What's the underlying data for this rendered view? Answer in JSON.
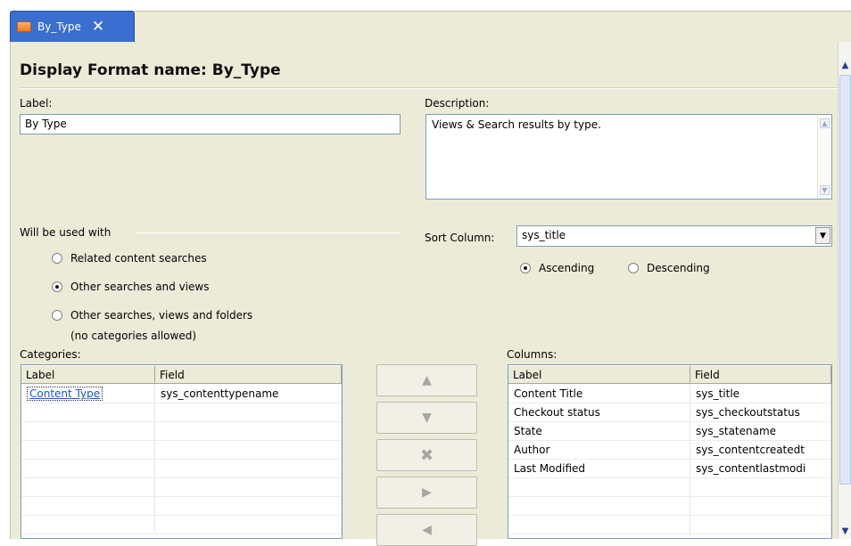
{
  "tab": {
    "title": "By_Type",
    "close_glyph": "✕",
    "icon": "display-format-icon"
  },
  "header": {
    "title": "Display Format name: By_Type"
  },
  "label_field": {
    "label": "Label:",
    "value": "By Type"
  },
  "description_field": {
    "label": "Description:",
    "value": "Views & Search results by type."
  },
  "usage": {
    "group_label": "Will be used with",
    "options": [
      {
        "label": "Related content searches",
        "selected": false
      },
      {
        "label": "Other searches and views",
        "selected": true
      },
      {
        "label": "Other searches, views and folders",
        "sublabel": "(no categories allowed)",
        "selected": false
      }
    ]
  },
  "sort": {
    "label": "Sort Column:",
    "value": "sys_title",
    "ascending": "Ascending",
    "descending": "Descending",
    "selected": "ascending"
  },
  "categories": {
    "label": "Categories:",
    "headers": [
      "Label",
      "Field"
    ],
    "rows": [
      [
        "Content Type",
        "sys_contenttypename"
      ]
    ]
  },
  "move_buttons": [
    "move-up-icon",
    "move-down-icon",
    "remove-icon",
    "move-right-icon",
    "move-left-icon"
  ],
  "columns": {
    "label": "Columns:",
    "headers": [
      "Label",
      "Field"
    ],
    "rows": [
      [
        "Content Title",
        "sys_title"
      ],
      [
        "Checkout status",
        "sys_checkoutstatus"
      ],
      [
        "State",
        "sys_statename"
      ],
      [
        "Author",
        "sys_contentcreatedt"
      ],
      [
        "Last Modified",
        "sys_contentlastmodi"
      ]
    ]
  }
}
